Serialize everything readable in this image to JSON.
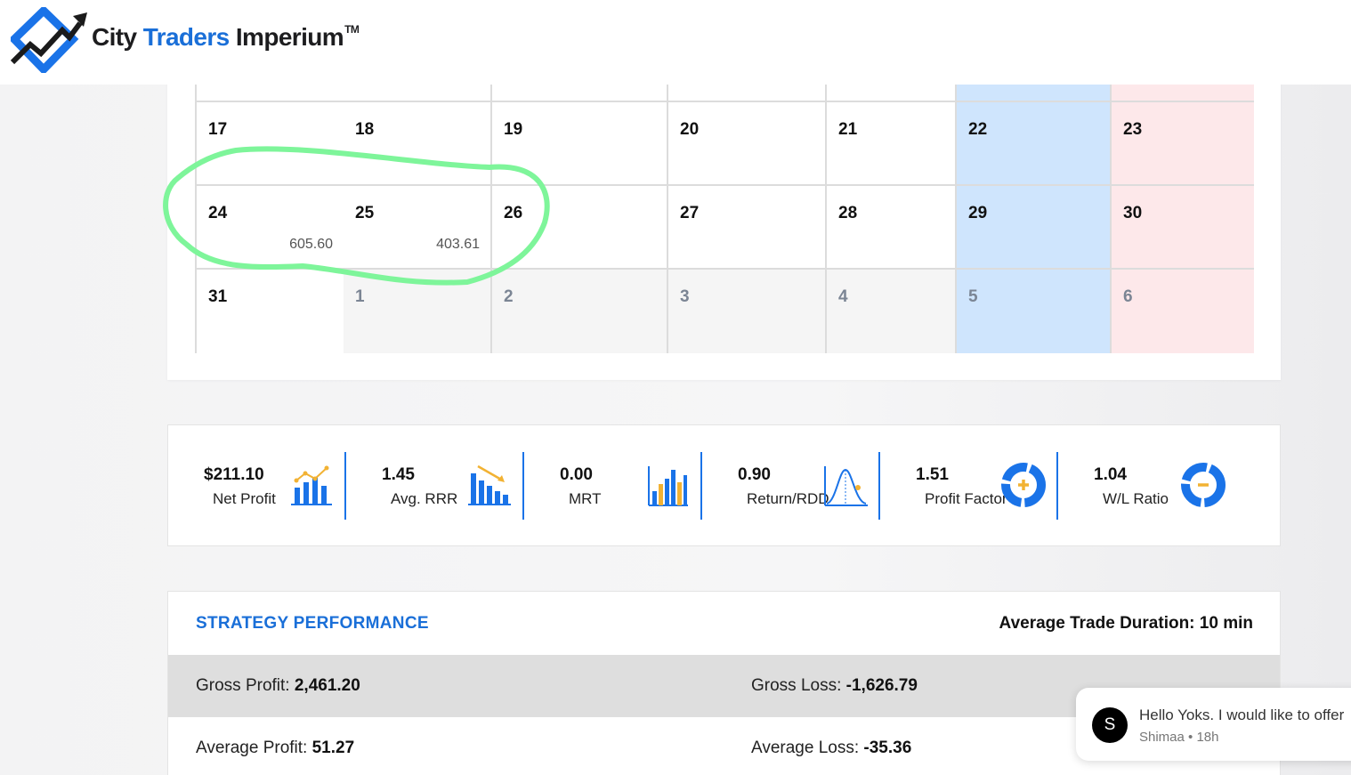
{
  "header": {
    "brand_part1": "City",
    "brand_part2": "Traders",
    "brand_part3": "Imperium",
    "brand_tm": "TM"
  },
  "calendar": {
    "rows": [
      [
        {
          "day": "17",
          "pl": "",
          "kind": "normal"
        },
        {
          "day": "18",
          "pl": "",
          "kind": "normal"
        },
        {
          "day": "19",
          "pl": "",
          "kind": "normal"
        },
        {
          "day": "20",
          "pl": "",
          "kind": "normal"
        },
        {
          "day": "21",
          "pl": "",
          "kind": "normal"
        },
        {
          "day": "22",
          "pl": "",
          "kind": "sat"
        },
        {
          "day": "23",
          "pl": "",
          "kind": "sun"
        }
      ],
      [
        {
          "day": "24",
          "pl": "605.60",
          "kind": "normal"
        },
        {
          "day": "25",
          "pl": "403.61",
          "kind": "normal"
        },
        {
          "day": "26",
          "pl": "",
          "kind": "normal"
        },
        {
          "day": "27",
          "pl": "",
          "kind": "normal"
        },
        {
          "day": "28",
          "pl": "",
          "kind": "normal"
        },
        {
          "day": "29",
          "pl": "",
          "kind": "sat"
        },
        {
          "day": "30",
          "pl": "",
          "kind": "sun"
        }
      ],
      [
        {
          "day": "31",
          "pl": "",
          "kind": "normal"
        },
        {
          "day": "1",
          "pl": "",
          "kind": "other"
        },
        {
          "day": "2",
          "pl": "",
          "kind": "other"
        },
        {
          "day": "3",
          "pl": "",
          "kind": "other"
        },
        {
          "day": "4",
          "pl": "",
          "kind": "other"
        },
        {
          "day": "5",
          "pl": "",
          "kind": "sat-muted"
        },
        {
          "day": "6",
          "pl": "",
          "kind": "sun-muted"
        }
      ]
    ],
    "highlight_color": "#7ef59a"
  },
  "stats": [
    {
      "value": "$211.10",
      "label": "Net Profit",
      "icon": "bar-chart-trend-icon"
    },
    {
      "value": "1.45",
      "label": "Avg. RRR",
      "icon": "bar-chart-down-icon"
    },
    {
      "value": "0.00",
      "label": "MRT",
      "icon": "bar-chart-mixed-icon"
    },
    {
      "value": "0.90",
      "label": "Return/RDD",
      "icon": "bell-curve-icon"
    },
    {
      "value": "1.51",
      "label": "Profit Factor",
      "icon": "donut-plus-icon"
    },
    {
      "value": "1.04",
      "label": "W/L Ratio",
      "icon": "donut-minus-icon"
    }
  ],
  "performance": {
    "title": "STRATEGY PERFORMANCE",
    "duration_label": "Average Trade Duration:",
    "duration_value": "10 min",
    "gross_profit_label": "Gross Profit:",
    "gross_profit_value": "2,461.20",
    "gross_loss_label": "Gross Loss:",
    "gross_loss_value": "-1,626.79",
    "avg_profit_label": "Average Profit:",
    "avg_profit_value": "51.27",
    "avg_loss_label": "Average Loss:",
    "avg_loss_value": "-35.36"
  },
  "toast": {
    "avatar_letter": "S",
    "message": "Hello Yoks. I would like to offer",
    "sender": "Shimaa",
    "separator": "•",
    "time": "18h"
  },
  "colors": {
    "brand_blue": "#1a6fd8",
    "saturday_bg": "#cfe5fd",
    "sunday_bg": "#fde8ea",
    "icon_blue": "#1a73e8",
    "icon_gold": "#f2b233"
  }
}
